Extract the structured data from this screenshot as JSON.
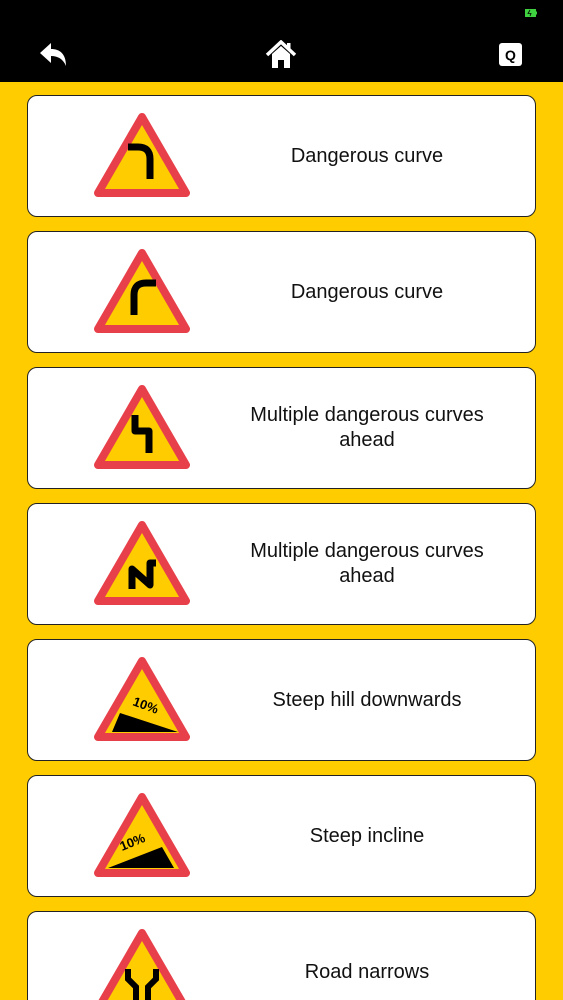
{
  "header": {
    "back_icon": "back-arrow-icon",
    "home_icon": "home-icon",
    "quiz_label": "Q",
    "status_color": "#3FD13F"
  },
  "signs": [
    {
      "label": "Dangerous curve",
      "icon": "curve-right-icon"
    },
    {
      "label": "Dangerous curve",
      "icon": "curve-left-icon"
    },
    {
      "label": "Multiple dangerous curves ahead",
      "icon": "double-curve-right-icon"
    },
    {
      "label": "Multiple dangerous curves ahead",
      "icon": "double-curve-left-icon"
    },
    {
      "label": "Steep hill downwards",
      "icon": "steep-descent-icon",
      "percent": "10%"
    },
    {
      "label": "Steep incline",
      "icon": "steep-ascent-icon",
      "percent": "10%"
    },
    {
      "label": "Road narrows",
      "icon": "road-narrows-icon"
    }
  ],
  "colors": {
    "background": "#FFCC00",
    "sign_border": "#E8404A",
    "sign_fill": "#FFCC00",
    "topbar": "#000000"
  }
}
